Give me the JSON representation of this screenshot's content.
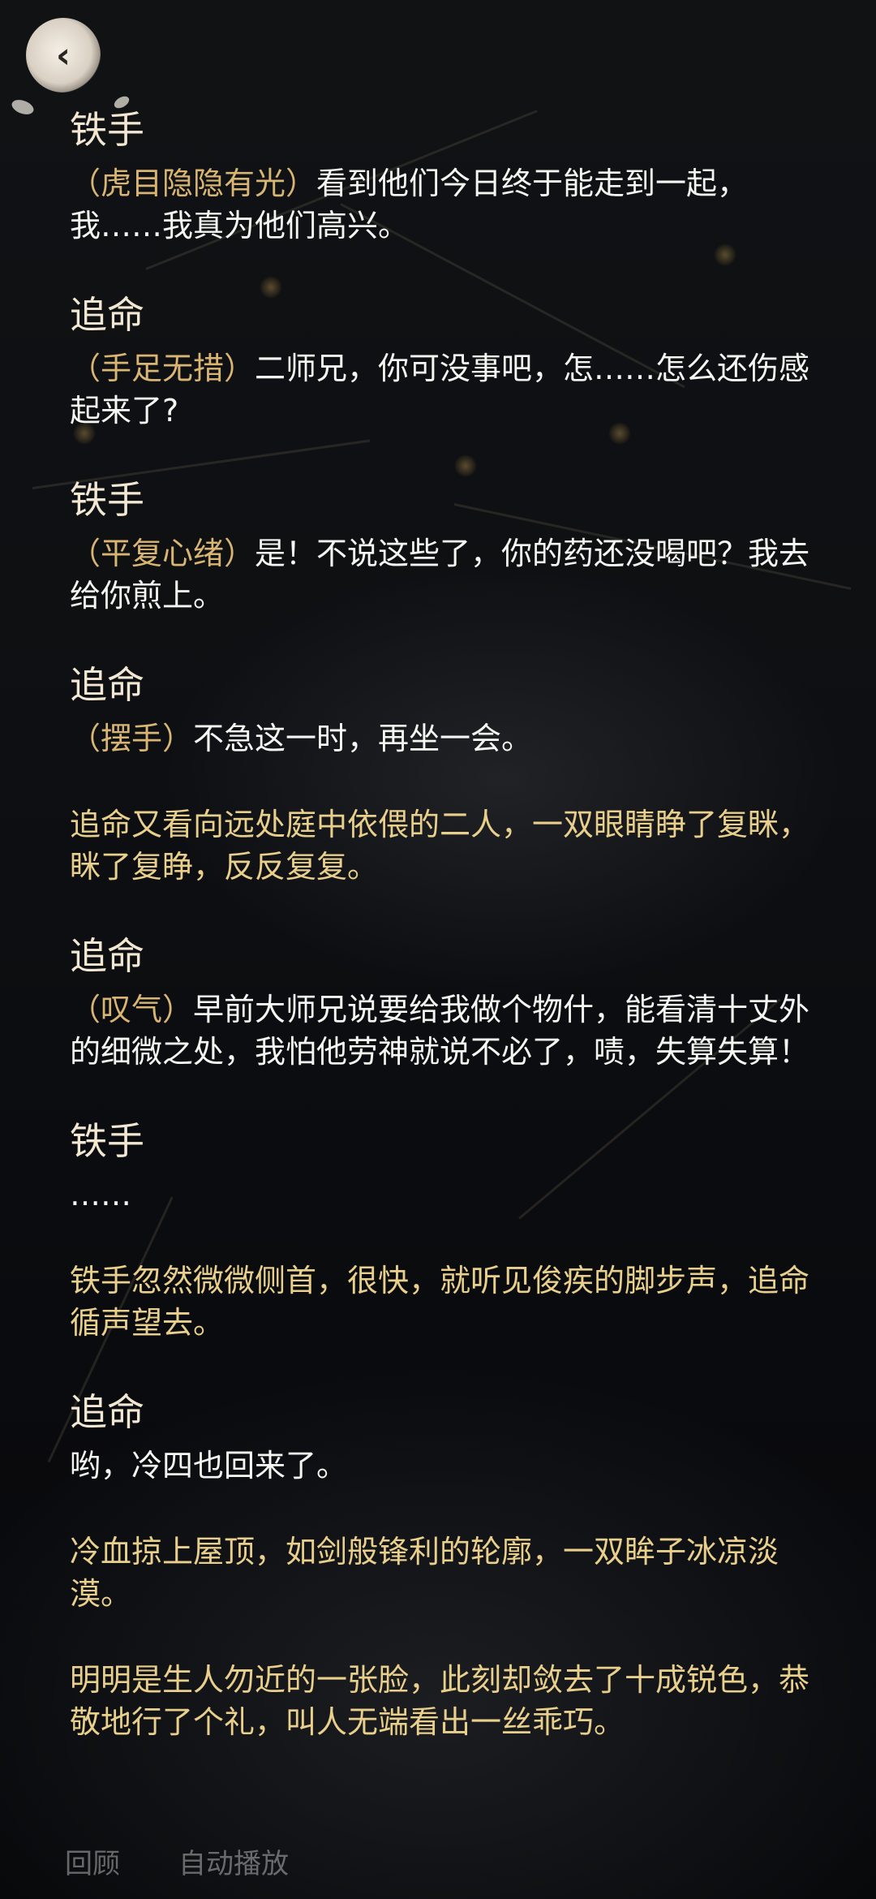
{
  "dialogue": [
    {
      "type": "speech",
      "speaker": "铁手",
      "action": "（虎目隐隐有光）",
      "text": "看到他们今日终于能走到一起，我……我真为他们高兴。"
    },
    {
      "type": "speech",
      "speaker": "追命",
      "action": "（手足无措）",
      "text": "二师兄，你可没事吧，怎……怎么还伤感起来了?"
    },
    {
      "type": "speech",
      "speaker": "铁手",
      "action": "（平复心绪）",
      "text": "是！不说这些了，你的药还没喝吧？我去给你煎上。"
    },
    {
      "type": "speech",
      "speaker": "追命",
      "action": "（摆手）",
      "text": "不急这一时，再坐一会。"
    },
    {
      "type": "narration",
      "text": "追命又看向远处庭中依偎的二人，一双眼睛睁了复眯，眯了复睁，反反复复。"
    },
    {
      "type": "speech",
      "speaker": "追命",
      "action": "（叹气）",
      "text": "早前大师兄说要给我做个物什，能看清十丈外的细微之处，我怕他劳神就说不必了，啧，失算失算！"
    },
    {
      "type": "speech",
      "speaker": "铁手",
      "action": "",
      "text": "……"
    },
    {
      "type": "narration",
      "text": "铁手忽然微微侧首，很快，就听见俊疾的脚步声，追命循声望去。"
    },
    {
      "type": "speech",
      "speaker": "追命",
      "action": "",
      "text": "哟，冷四也回来了。"
    },
    {
      "type": "narration",
      "text": "冷血掠上屋顶，如剑般锋利的轮廓，一双眸子冰凉淡漠。"
    },
    {
      "type": "narration",
      "text": "明明是生人勿近的一张脸，此刻却敛去了十成锐色，恭敬地行了个礼，叫人无端看出一丝乖巧。"
    }
  ],
  "bottom_bar": {
    "review_label": "回顾",
    "autoplay_label": "自动播放"
  },
  "icons": {
    "back": "back-arrow-icon"
  },
  "colors": {
    "speaker": "#f1e7d2",
    "action": "#d9b574",
    "narration": "#e9cf8c",
    "text": "#f5f5f2"
  }
}
